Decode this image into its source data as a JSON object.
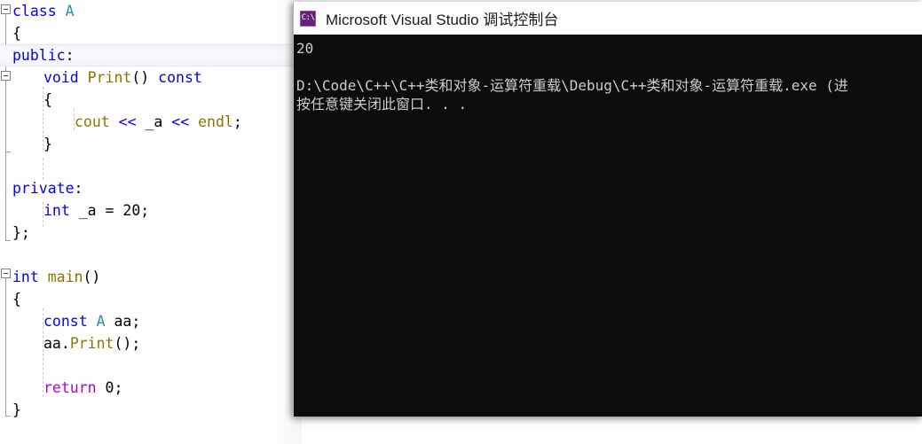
{
  "editor": {
    "name": "code-editor",
    "language": "cpp",
    "current_line_index": 2,
    "lines": [
      {
        "indent": 0,
        "tokens": [
          {
            "t": "class ",
            "c": "kw"
          },
          {
            "t": "A",
            "c": "type"
          }
        ]
      },
      {
        "indent": 0,
        "tokens": [
          {
            "t": "{",
            "c": "plain"
          }
        ]
      },
      {
        "indent": 0,
        "tokens": [
          {
            "t": "public",
            "c": "kw"
          },
          {
            "t": ":",
            "c": "plain"
          }
        ]
      },
      {
        "indent": 1,
        "tokens": [
          {
            "t": "void ",
            "c": "kw"
          },
          {
            "t": "Print",
            "c": "fn"
          },
          {
            "t": "() ",
            "c": "plain"
          },
          {
            "t": "const",
            "c": "kw"
          }
        ]
      },
      {
        "indent": 1,
        "tokens": [
          {
            "t": "{",
            "c": "plain"
          }
        ]
      },
      {
        "indent": 2,
        "tokens": [
          {
            "t": "cout ",
            "c": "fn"
          },
          {
            "t": "<< ",
            "c": "op"
          },
          {
            "t": "_a ",
            "c": "plain"
          },
          {
            "t": "<< ",
            "c": "op"
          },
          {
            "t": "endl",
            "c": "fn"
          },
          {
            "t": ";",
            "c": "plain"
          }
        ]
      },
      {
        "indent": 1,
        "tokens": [
          {
            "t": "}",
            "c": "plain"
          }
        ]
      },
      {
        "indent": 0,
        "tokens": []
      },
      {
        "indent": 0,
        "tokens": [
          {
            "t": "private",
            "c": "kw"
          },
          {
            "t": ":",
            "c": "plain"
          }
        ]
      },
      {
        "indent": 1,
        "tokens": [
          {
            "t": "int ",
            "c": "kw"
          },
          {
            "t": "_a = ",
            "c": "plain"
          },
          {
            "t": "20",
            "c": "num"
          },
          {
            "t": ";",
            "c": "plain"
          }
        ]
      },
      {
        "indent": 0,
        "tokens": [
          {
            "t": "};",
            "c": "plain"
          }
        ]
      },
      {
        "indent": 0,
        "tokens": []
      },
      {
        "indent": 0,
        "tokens": [
          {
            "t": "int ",
            "c": "kw"
          },
          {
            "t": "main",
            "c": "fn"
          },
          {
            "t": "()",
            "c": "plain"
          }
        ]
      },
      {
        "indent": 0,
        "tokens": [
          {
            "t": "{",
            "c": "plain"
          }
        ]
      },
      {
        "indent": 1,
        "tokens": [
          {
            "t": "const ",
            "c": "kw"
          },
          {
            "t": "A ",
            "c": "type"
          },
          {
            "t": "aa;",
            "c": "plain"
          }
        ]
      },
      {
        "indent": 1,
        "tokens": [
          {
            "t": "aa.",
            "c": "plain"
          },
          {
            "t": "Print",
            "c": "fn"
          },
          {
            "t": "();",
            "c": "plain"
          }
        ]
      },
      {
        "indent": 1,
        "tokens": []
      },
      {
        "indent": 1,
        "tokens": [
          {
            "t": "return ",
            "c": "ret"
          },
          {
            "t": "0",
            "c": "num"
          },
          {
            "t": ";",
            "c": "plain"
          }
        ]
      },
      {
        "indent": 0,
        "tokens": [
          {
            "t": "}",
            "c": "plain"
          }
        ]
      }
    ],
    "plain_text": "class A\n{\npublic:\n    void Print() const\n    {\n        cout << _a << endl;\n    }\n\nprivate:\n    int _a = 20;\n};\n\nint main()\n{\n    const A aa;\n    aa.Print();\n\n    return 0;\n}",
    "fold_markers": [
      {
        "line": 0,
        "state": "expanded"
      },
      {
        "line": 3,
        "state": "expanded"
      },
      {
        "line": 12,
        "state": "expanded"
      }
    ],
    "colors": {
      "keyword": "#0000ff",
      "return_keyword": "#af00db",
      "type": "#2b91af",
      "function": "#8b7500",
      "plain": "#000000",
      "background": "#ffffff"
    }
  },
  "console": {
    "name": "debug-console-window",
    "title": "Microsoft Visual Studio 调试控制台",
    "icon": "console-app-icon",
    "icon_glyph": "C:\\",
    "icon_color": "#68217a",
    "background": "#0c0c0c",
    "foreground": "#cccccc",
    "lines": [
      "20",
      "",
      "D:\\Code\\C++\\C++类和对象-运算符重载\\Debug\\C++类和对象-运算符重载.exe (进",
      "按任意键关闭此窗口. . ."
    ],
    "program_output": "20",
    "exit_message_path": "D:\\Code\\C++\\C++类和对象-运算符重载\\Debug\\C++类和对象-运算符重载.exe",
    "close_prompt": "按任意键关闭此窗口. . ."
  }
}
